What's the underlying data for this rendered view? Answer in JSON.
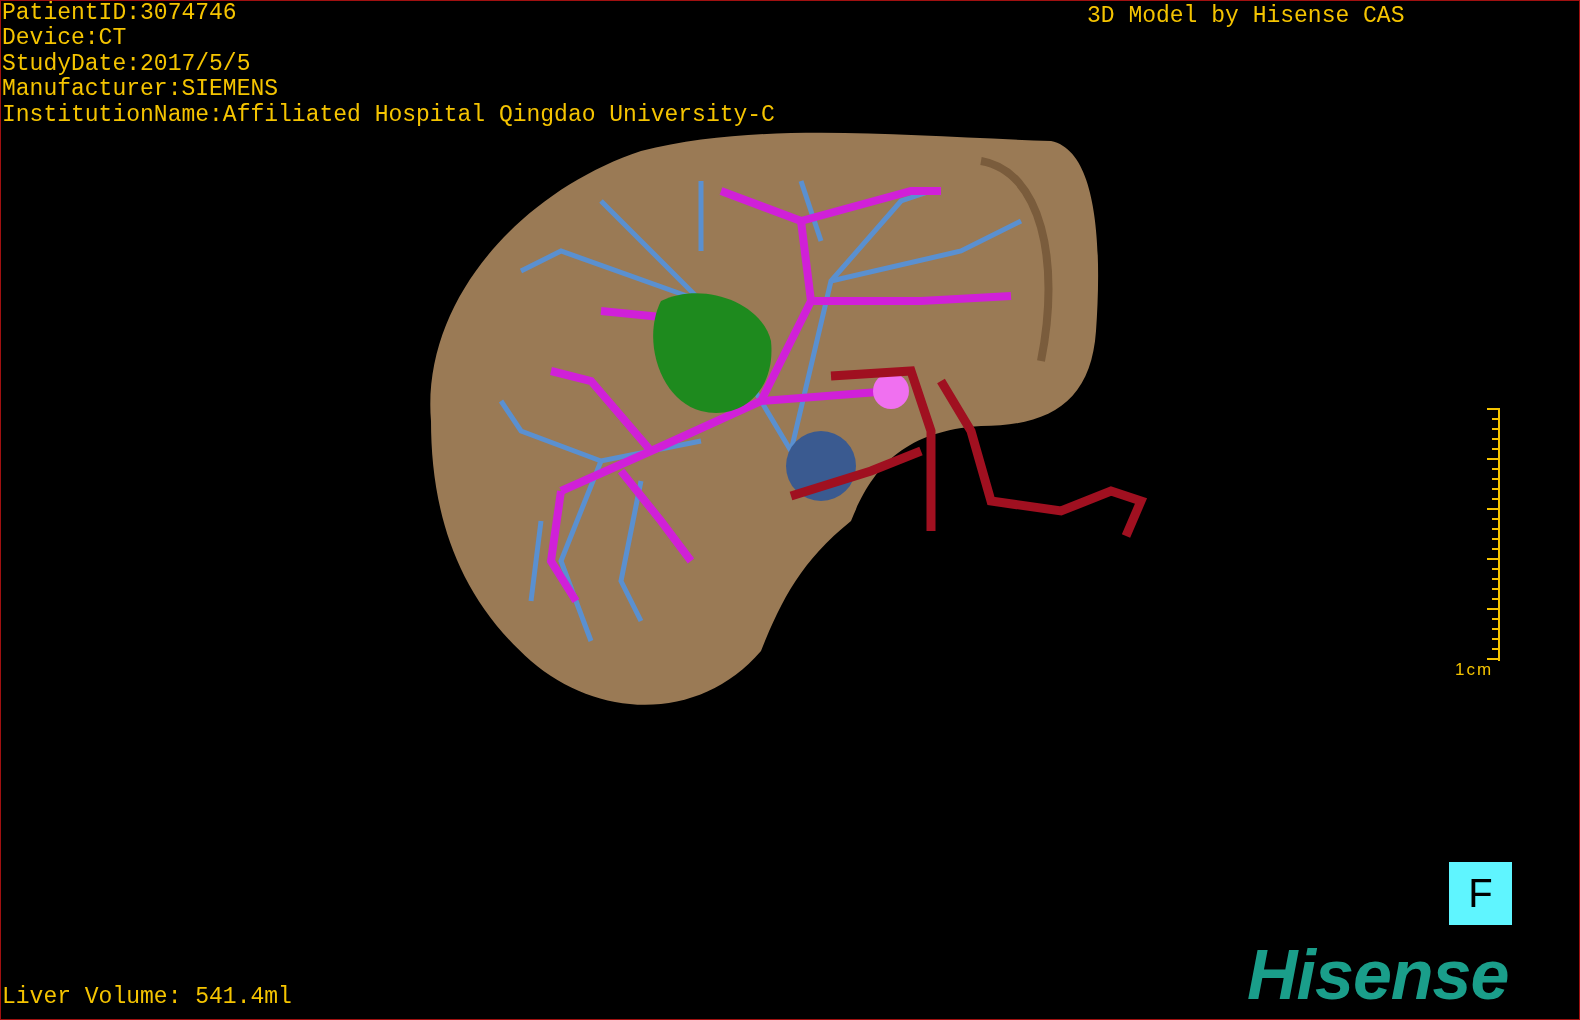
{
  "patient_info": [
    "PatientID:3074746",
    "Device:CT",
    "StudyDate:2017/5/5",
    "Manufacturer:SIEMENS",
    "InstitutionName:Affiliated Hospital Qingdao University-C"
  ],
  "model_credit": "3D Model by Hisense CAS",
  "scale_bar": {
    "label": "1cm"
  },
  "orientation_marker": "F",
  "brand_logo": "Hisense",
  "liver_volume": "Liver Volume: 541.4ml"
}
